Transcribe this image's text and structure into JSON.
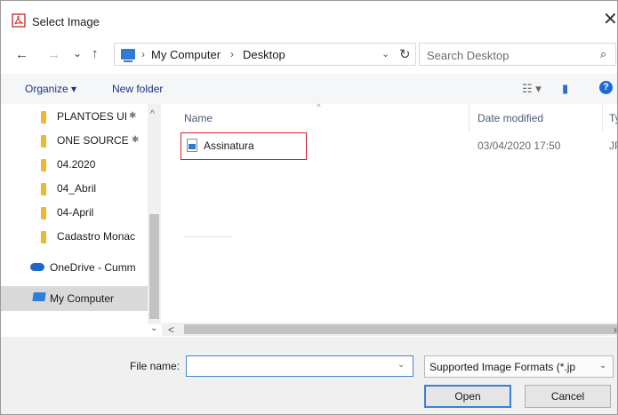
{
  "window": {
    "title": "Select Image",
    "close_glyph": "✕",
    "icon": "pdf-app-icon"
  },
  "nav": {
    "back": "←",
    "forward": "→",
    "recent": "⌄",
    "up": "↑"
  },
  "address": {
    "crumbs": [
      "My Computer",
      "Desktop"
    ],
    "separator": "›",
    "dropdown": "⌄",
    "refresh": "↻"
  },
  "search": {
    "placeholder": "Search Desktop",
    "icon": "⌕"
  },
  "toolbar": {
    "organize": "Organize ▾",
    "new_folder": "New folder",
    "view_glyph": "☷ ▾",
    "pane_glyph": "▮",
    "help": "?"
  },
  "sidebar": {
    "items": [
      {
        "label": "PLANTOES UI",
        "pinned": true
      },
      {
        "label": "ONE SOURCE",
        "pinned": true
      },
      {
        "label": "04.2020",
        "pinned": false
      },
      {
        "label": "04_Abril",
        "pinned": false
      },
      {
        "label": "04-April",
        "pinned": false
      },
      {
        "label": "Cadastro Monac",
        "pinned": false
      },
      {
        "label": "OneDrive - Cumm",
        "pinned": false
      },
      {
        "label": "My Computer",
        "pinned": false
      }
    ],
    "pin_glyph": "✱",
    "scroll_up": "^",
    "scroll_down": "⌄"
  },
  "columns": {
    "name": "Name",
    "date": "Date modified",
    "type": "Ty"
  },
  "files": [
    {
      "name": "Assinatura",
      "date": "03/04/2020 17:50",
      "type": "JP"
    }
  ],
  "hscroll": {
    "left_arrow": "<",
    "right_arrow": "›"
  },
  "bottom": {
    "file_name_label": "File name:",
    "file_name_value": "",
    "dropdown": "⌄",
    "file_type": "Supported Image Formats (*.jp",
    "type_chevron": "⌄",
    "open": "Open",
    "cancel": "Cancel"
  },
  "colors": {
    "accent": "#2d7bd2",
    "highlight_border": "#d0232b",
    "selected_bg": "#d9d9d9",
    "folder": "#e8b93a"
  }
}
